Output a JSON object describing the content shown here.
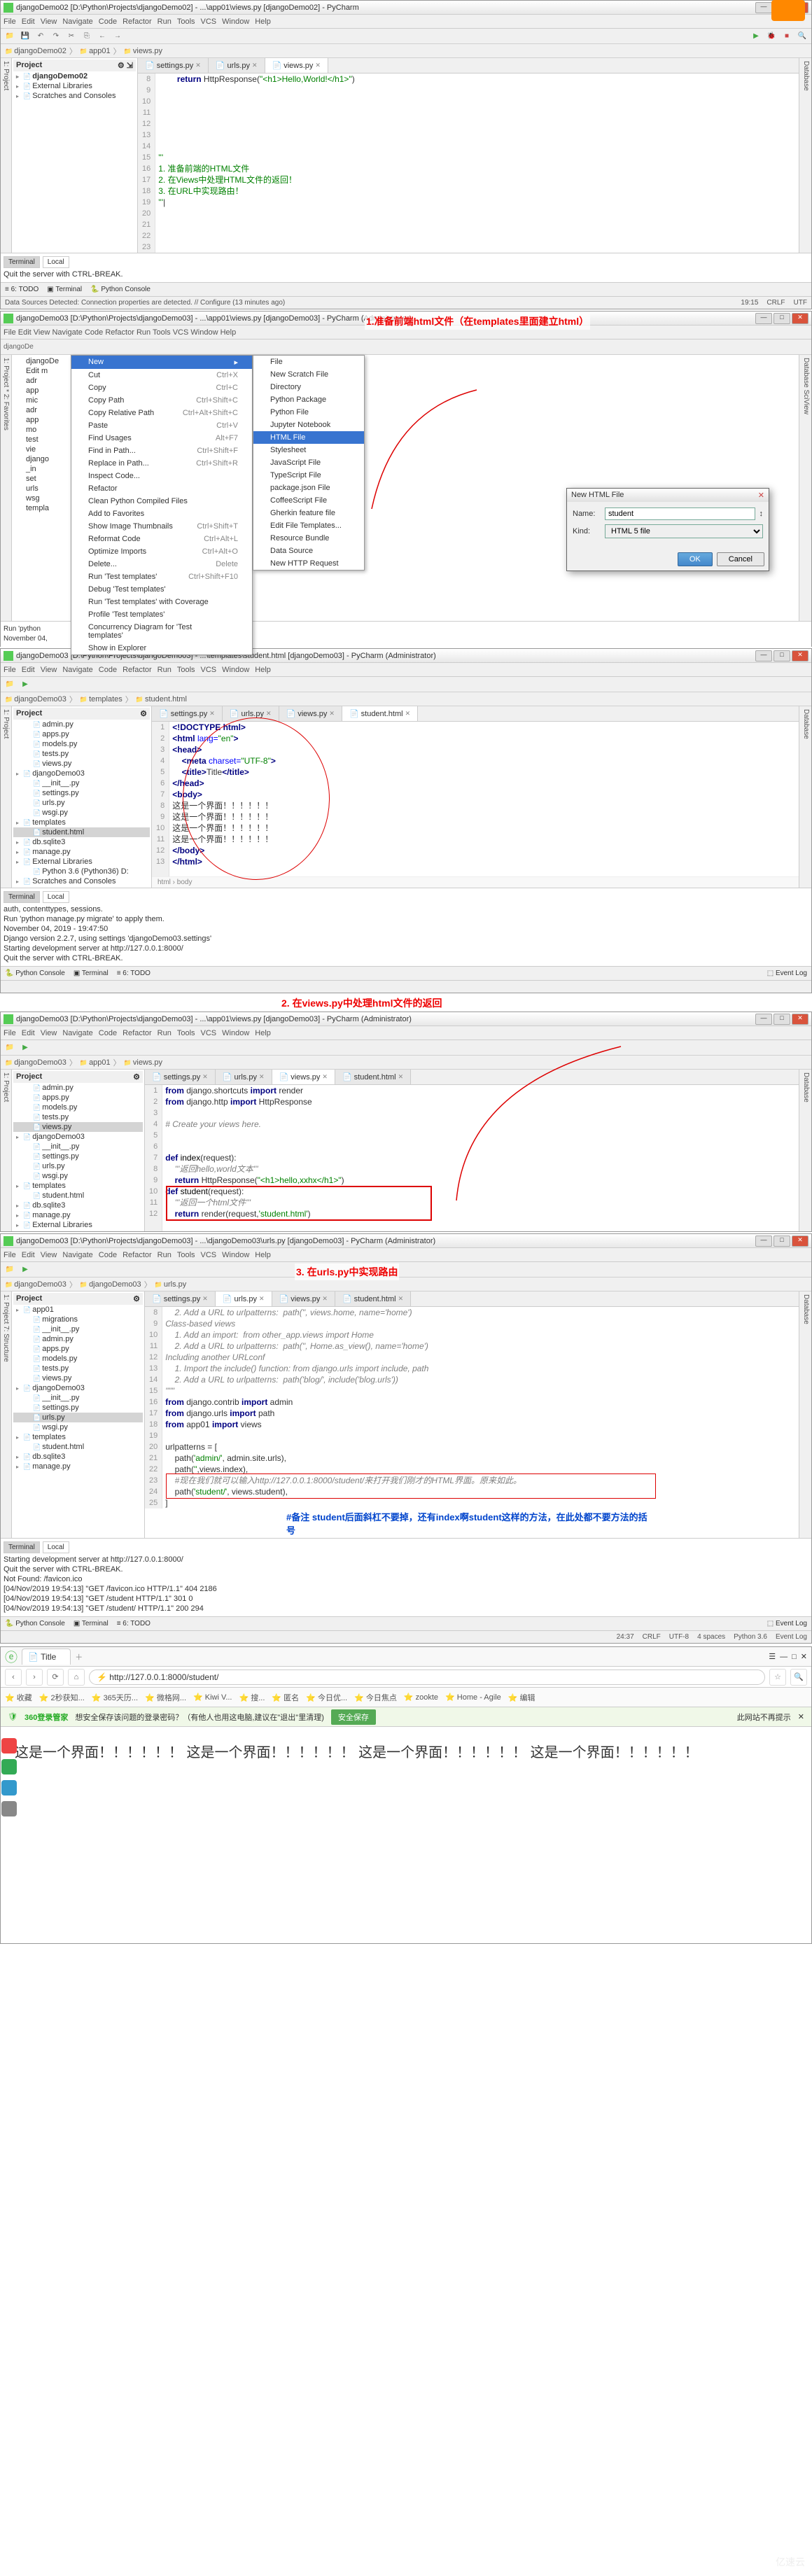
{
  "screenshot1": {
    "title": "djangoDemo02 [D:\\Python\\Projects\\djangoDemo02] - ...\\app01\\views.py [djangoDemo02] - PyCharm",
    "menus": [
      "File",
      "Edit",
      "View",
      "Navigate",
      "Code",
      "Refactor",
      "Run",
      "Tools",
      "VCS",
      "Window",
      "Help"
    ],
    "breadcrumbs": [
      "djangoDemo02",
      "app01",
      "views.py"
    ],
    "project_header": "Project",
    "tree": [
      {
        "l": 1,
        "t": "djangoDemo02",
        "bold": true
      },
      {
        "l": 1,
        "t": "External Libraries"
      },
      {
        "l": 1,
        "t": "Scratches and Consoles"
      }
    ],
    "tabs": [
      {
        "label": "settings.py"
      },
      {
        "label": "urls.py"
      },
      {
        "label": "views.py",
        "active": true
      }
    ],
    "gutter_start": 8,
    "gutter_end": 23,
    "code": [
      {
        "n": 8,
        "html": "        <span class='kw'>return</span> HttpResponse(<span class='str'>\"&lt;h1&gt;Hello,World!&lt;/h1&gt;\"</span>)"
      },
      {
        "n": 9,
        "html": ""
      },
      {
        "n": 10,
        "html": ""
      },
      {
        "n": 11,
        "html": ""
      },
      {
        "n": 12,
        "html": ""
      },
      {
        "n": 13,
        "html": ""
      },
      {
        "n": 14,
        "html": ""
      },
      {
        "n": 15,
        "html": "<span class='str'>'''</span>"
      },
      {
        "n": 16,
        "html": "<span class='str'>1. 准备前端的HTML文件</span>"
      },
      {
        "n": 17,
        "html": "<span class='str'>2. 在Views中处理HTML文件的返回！</span>"
      },
      {
        "n": 18,
        "html": "<span class='str'>3. 在URL中实现路由！</span>"
      },
      {
        "n": 19,
        "html": "<span class='str'>'''</span>|"
      },
      {
        "n": 20,
        "html": ""
      },
      {
        "n": 21,
        "html": ""
      },
      {
        "n": 22,
        "html": ""
      },
      {
        "n": 23,
        "html": ""
      }
    ],
    "terminal_tabs": [
      "Terminal",
      "Local"
    ],
    "terminal_lines": [
      "Quit the server with CTRL-BREAK.",
      ""
    ],
    "bottom": [
      "TODO",
      "Terminal",
      "Python Console"
    ],
    "databar": "Data Sources Detected: Connection properties are detected. // Configure (13 minutes ago)",
    "status_right": [
      "19:15",
      "CRLF",
      "UTF"
    ]
  },
  "screenshot2": {
    "title": "djangoDemo03 [D:\\Python\\Projects\\djangoDemo03] - ...\\app01\\views.py [djangoDemo03] - PyCharm (Administrator)",
    "annotation": "1.准备前端html文件（在templates里面建立html）",
    "menubar_note": "File  Edit  View  Navigate  Code  Refactor  Run  Tools  VCS  Window  Help",
    "context_left_header": "New",
    "context_left": [
      {
        "t": "Cut",
        "s": "Ctrl+X"
      },
      {
        "t": "Copy",
        "s": "Ctrl+C"
      },
      {
        "t": "Copy Path",
        "s": "Ctrl+Shift+C"
      },
      {
        "t": "Copy Relative Path",
        "s": "Ctrl+Alt+Shift+C"
      },
      {
        "t": "Paste",
        "s": "Ctrl+V"
      },
      {
        "t": "Find Usages",
        "s": "Alt+F7"
      },
      {
        "t": "Find in Path...",
        "s": "Ctrl+Shift+F"
      },
      {
        "t": "Replace in Path...",
        "s": "Ctrl+Shift+R"
      },
      {
        "t": "Inspect Code...",
        "s": ""
      },
      {
        "t": "Refactor",
        "s": ""
      },
      {
        "t": "Clean Python Compiled Files",
        "s": ""
      },
      {
        "t": "Add to Favorites",
        "s": ""
      },
      {
        "t": "Show Image Thumbnails",
        "s": "Ctrl+Shift+T"
      },
      {
        "t": "Reformat Code",
        "s": "Ctrl+Alt+L"
      },
      {
        "t": "Optimize Imports",
        "s": "Ctrl+Alt+O"
      },
      {
        "t": "Delete...",
        "s": "Delete"
      },
      {
        "t": "Run 'Test templates'",
        "s": "Ctrl+Shift+F10"
      },
      {
        "t": "Debug 'Test templates'",
        "s": ""
      },
      {
        "t": "Run 'Test templates' with Coverage",
        "s": ""
      },
      {
        "t": "Profile 'Test templates'",
        "s": ""
      },
      {
        "t": "Concurrency Diagram for 'Test templates'",
        "s": ""
      },
      {
        "t": "Show in Explorer",
        "s": ""
      }
    ],
    "context_right": [
      {
        "t": "File"
      },
      {
        "t": "New Scratch File"
      },
      {
        "t": "Directory"
      },
      {
        "t": "Python Package"
      },
      {
        "t": "Python File"
      },
      {
        "t": "Jupyter Notebook"
      },
      {
        "t": "HTML File",
        "hover": true
      },
      {
        "t": "Stylesheet"
      },
      {
        "t": "JavaScript File"
      },
      {
        "t": "TypeScript File"
      },
      {
        "t": "package.json File"
      },
      {
        "t": "CoffeeScript File"
      },
      {
        "t": "Gherkin feature file"
      },
      {
        "t": "Edit File Templates..."
      },
      {
        "t": "Resource Bundle"
      },
      {
        "t": "Data Source"
      },
      {
        "t": "New HTTP Request"
      }
    ],
    "tree_partial": [
      "djangoDe",
      "Edit m",
      "adr",
      "app",
      "mic",
      "adr",
      "app",
      "mo",
      "test",
      "vie",
      "django",
      "_in",
      "set",
      "urls",
      "wsg",
      "templa"
    ],
    "dialog": {
      "title": "New HTML File",
      "name_label": "Name:",
      "name_value": "student",
      "kind_label": "Kind:",
      "kind_value": "HTML 5 file",
      "ok": "OK",
      "cancel": "Cancel"
    },
    "terminal_lines": [
      "Run 'python ",
      "November 04,"
    ],
    "status_left": "2 Favorites"
  },
  "screenshot3": {
    "title": "djangoDemo03 [D:\\Python\\Projects\\djangoDemo03] - ...\\templates\\student.html [djangoDemo03] - PyCharm (Administrator)",
    "breadcrumbs": [
      "djangoDemo03",
      "templates",
      "student.html"
    ],
    "tree": [
      {
        "l": 2,
        "t": "admin.py"
      },
      {
        "l": 2,
        "t": "apps.py"
      },
      {
        "l": 2,
        "t": "models.py"
      },
      {
        "l": 2,
        "t": "tests.py"
      },
      {
        "l": 2,
        "t": "views.py"
      },
      {
        "l": 1,
        "t": "djangoDemo03"
      },
      {
        "l": 2,
        "t": "__init__.py"
      },
      {
        "l": 2,
        "t": "settings.py"
      },
      {
        "l": 2,
        "t": "urls.py"
      },
      {
        "l": 2,
        "t": "wsgi.py"
      },
      {
        "l": 1,
        "t": "templates"
      },
      {
        "l": 2,
        "t": "student.html",
        "sel": true
      },
      {
        "l": 1,
        "t": "db.sqlite3"
      },
      {
        "l": 1,
        "t": "manage.py"
      },
      {
        "l": 1,
        "t": "External Libraries"
      },
      {
        "l": 2,
        "t": "Python 3.6 (Python36) D:"
      },
      {
        "l": 1,
        "t": "Scratches and Consoles"
      }
    ],
    "tabs": [
      {
        "label": "settings.py"
      },
      {
        "label": "urls.py"
      },
      {
        "label": "views.py"
      },
      {
        "label": "student.html",
        "active": true
      }
    ],
    "code": [
      {
        "n": 1,
        "html": "<span class='tag'>&lt;!DOCTYPE html&gt;</span>"
      },
      {
        "n": 2,
        "html": "<span class='tag'>&lt;html</span> <span class='attr'>lang=</span><span class='str'>\"en\"</span><span class='tag'>&gt;</span>"
      },
      {
        "n": 3,
        "html": "<span class='tag'>&lt;head&gt;</span>"
      },
      {
        "n": 4,
        "html": "    <span class='tag'>&lt;meta</span> <span class='attr'>charset=</span><span class='str'>\"UTF-8\"</span><span class='tag'>&gt;</span>"
      },
      {
        "n": 5,
        "html": "    <span class='tag'>&lt;title&gt;</span>Title<span class='tag'>&lt;/title&gt;</span>"
      },
      {
        "n": 6,
        "html": "<span class='tag'>&lt;/head&gt;</span>"
      },
      {
        "n": 7,
        "html": "<span class='tag'>&lt;body&gt;</span>"
      },
      {
        "n": 8,
        "html": "这是一个界面！！！！！！"
      },
      {
        "n": 9,
        "html": "这是一个界面！！！！！！"
      },
      {
        "n": 10,
        "html": "这是一个界面！！！！！！"
      },
      {
        "n": 11,
        "html": "这是一个界面！！！！！！"
      },
      {
        "n": 12,
        "html": "<span class='tag'>&lt;/body&gt;</span>"
      },
      {
        "n": 13,
        "html": "<span class='tag'>&lt;/html&gt;</span>"
      }
    ],
    "breadcrumb_bottom": "html › body",
    "terminal_lines": [
      " auth, contenttypes, sessions.",
      " Run 'python manage.py migrate' to apply them.",
      "November 04, 2019 - 19:47:50",
      "Django version 2.2.7, using settings 'djangoDemo03.settings'",
      "Starting development server at http://127.0.0.1:8000/",
      "Quit the server with CTRL-BREAK."
    ],
    "bottom": [
      "Python Console",
      "Terminal",
      "TODO"
    ],
    "status_right": [
      "Event Log"
    ],
    "annotation": "2. 在views.py中处理html文件的返回"
  },
  "screenshot4": {
    "title": "djangoDemo03 [D:\\Python\\Projects\\djangoDemo03] - ...\\app01\\views.py [djangoDemo03] - PyCharm (Administrator)",
    "breadcrumbs": [
      "djangoDemo03",
      "app01",
      "views.py"
    ],
    "tree": [
      {
        "l": 2,
        "t": "admin.py"
      },
      {
        "l": 2,
        "t": "apps.py"
      },
      {
        "l": 2,
        "t": "models.py"
      },
      {
        "l": 2,
        "t": "tests.py"
      },
      {
        "l": 2,
        "t": "views.py",
        "sel": true
      },
      {
        "l": 1,
        "t": "djangoDemo03"
      },
      {
        "l": 2,
        "t": "__init__.py"
      },
      {
        "l": 2,
        "t": "settings.py"
      },
      {
        "l": 2,
        "t": "urls.py"
      },
      {
        "l": 2,
        "t": "wsgi.py"
      },
      {
        "l": 1,
        "t": "templates"
      },
      {
        "l": 2,
        "t": "student.html"
      },
      {
        "l": 1,
        "t": "db.sqlite3"
      },
      {
        "l": 1,
        "t": "manage.py"
      },
      {
        "l": 1,
        "t": "External Libraries"
      }
    ],
    "tabs": [
      {
        "label": "settings.py"
      },
      {
        "label": "urls.py"
      },
      {
        "label": "views.py",
        "active": true
      },
      {
        "label": "student.html"
      }
    ],
    "code": [
      {
        "n": 1,
        "html": "<span class='kw'>from</span> django.shortcuts <span class='kw'>import</span> render"
      },
      {
        "n": 2,
        "html": "<span class='kw'>from</span> django.http <span class='kw'>import</span> HttpResponse"
      },
      {
        "n": 3,
        "html": ""
      },
      {
        "n": 4,
        "html": "<span class='com'># Create your views here.</span>"
      },
      {
        "n": 5,
        "html": ""
      },
      {
        "n": 6,
        "html": ""
      },
      {
        "n": 7,
        "html": "<span class='kw'>def</span> <span class='fn'>index</span>(request):"
      },
      {
        "n": 8,
        "html": "    <span class='com'>'''返回hello,world文本'''</span>"
      },
      {
        "n": 9,
        "html": "    <span class='kw'>return</span> HttpResponse(<span class='str'>\"&lt;h1&gt;hello,xxhx&lt;/h1&gt;\"</span>)"
      },
      {
        "n": 10,
        "html": "<span class='kw'>def</span> <span class='fn'>student</span>(request):"
      },
      {
        "n": 11,
        "html": "    <span class='com'>'''返回一个html文件'''</span>"
      },
      {
        "n": 12,
        "html": "    <span class='kw'>return</span> render(request,<span class='str'>'student.html'</span>)"
      }
    ]
  },
  "screenshot5": {
    "title": "djangoDemo03 [D:\\Python\\Projects\\djangoDemo03] - ...\\djangoDemo03\\urls.py [djangoDemo03] - PyCharm (Administrator)",
    "annotation": "3. 在urls.py中实现路由",
    "breadcrumbs": [
      "djangoDemo03",
      "djangoDemo03",
      "urls.py"
    ],
    "tree": [
      {
        "l": 1,
        "t": "app01"
      },
      {
        "l": 2,
        "t": "migrations"
      },
      {
        "l": 2,
        "t": "__init__.py"
      },
      {
        "l": 2,
        "t": "admin.py"
      },
      {
        "l": 2,
        "t": "apps.py"
      },
      {
        "l": 2,
        "t": "models.py"
      },
      {
        "l": 2,
        "t": "tests.py"
      },
      {
        "l": 2,
        "t": "views.py"
      },
      {
        "l": 1,
        "t": "djangoDemo03"
      },
      {
        "l": 2,
        "t": "__init__.py"
      },
      {
        "l": 2,
        "t": "settings.py"
      },
      {
        "l": 2,
        "t": "urls.py",
        "sel": true
      },
      {
        "l": 2,
        "t": "wsgi.py"
      },
      {
        "l": 1,
        "t": "templates"
      },
      {
        "l": 2,
        "t": "student.html"
      },
      {
        "l": 1,
        "t": "db.sqlite3"
      },
      {
        "l": 1,
        "t": "manage.py"
      }
    ],
    "tabs": [
      {
        "label": "settings.py"
      },
      {
        "label": "urls.py",
        "active": true
      },
      {
        "label": "views.py"
      },
      {
        "label": "student.html"
      }
    ],
    "code": [
      {
        "n": 8,
        "html": "    <span class='com'>2. Add a URL to urlpatterns:  path('', views.home, name='home')</span>"
      },
      {
        "n": 9,
        "html": "<span class='com'>Class-based views</span>"
      },
      {
        "n": 10,
        "html": "    <span class='com'>1. Add an import:  from other_app.views import Home</span>"
      },
      {
        "n": 11,
        "html": "    <span class='com'>2. Add a URL to urlpatterns:  path('', Home.as_view(), name='home')</span>"
      },
      {
        "n": 12,
        "html": "<span class='com'>Including another URLconf</span>"
      },
      {
        "n": 13,
        "html": "    <span class='com'>1. Import the include() function: from django.urls import include, path</span>"
      },
      {
        "n": 14,
        "html": "    <span class='com'>2. Add a URL to urlpatterns:  path('blog/', include('blog.urls'))</span>"
      },
      {
        "n": 15,
        "html": "<span class='com'>\"\"\"</span>"
      },
      {
        "n": 16,
        "html": "<span class='kw'>from</span> django.contrib <span class='kw'>import</span> admin"
      },
      {
        "n": 17,
        "html": "<span class='kw'>from</span> django.urls <span class='kw'>import</span> path"
      },
      {
        "n": 18,
        "html": "<span class='kw'>from</span> app01 <span class='kw'>import</span> views"
      },
      {
        "n": 19,
        "html": ""
      },
      {
        "n": 20,
        "html": "urlpatterns = ["
      },
      {
        "n": 21,
        "html": "    path(<span class='str'>'admin/'</span>, admin.site.urls),"
      },
      {
        "n": 22,
        "html": "    path(<span class='str'>''</span>,views.index),"
      },
      {
        "n": 23,
        "html": "    <span class='com'>#现在我们就可以输入http://127.0.0.1:8000/student/来打开我们刚才的HTML界面。原来如此。</span>"
      },
      {
        "n": 24,
        "html": "    path(<span class='str'>'student/'</span>, views.student),"
      },
      {
        "n": 25,
        "html": "]"
      }
    ],
    "annotation2": "#备注  student后面斜杠不要掉，还有index啊student这样的方法，在此处都不要方法的括号",
    "terminal_tabs": [
      "Terminal",
      "Local"
    ],
    "terminal_lines": [
      "Starting development server at http://127.0.0.1:8000/",
      "Quit the server with CTRL-BREAK.",
      "Not Found: /favicon.ico",
      "[04/Nov/2019 19:54:13] \"GET /favicon.ico HTTP/1.1\" 404 2186",
      "[04/Nov/2019 19:54:13] \"GET /student HTTP/1.1\" 301 0",
      "[04/Nov/2019 19:54:13] \"GET /student/ HTTP/1.1\" 200 294"
    ],
    "bottom": [
      "Python Console",
      "Terminal",
      "TODO"
    ],
    "status_right": [
      "24:37",
      "CRLF",
      "UTF-8",
      "4 spaces",
      "Python 3.6",
      "Event Log"
    ]
  },
  "browser": {
    "tab": "Title",
    "url": "http://127.0.0.1:8000/student/",
    "bookmarks": [
      "收藏",
      "2秒获知...",
      "365天历...",
      "微格网...",
      "Kiwi V...",
      "搜...",
      "匿名",
      "今日优...",
      "今日焦点",
      "zookte",
      "Home - Agile",
      "编辑"
    ],
    "sectext": "想安全保存该问题的登录密码？（有他人也用这电脑,建议在\"退出\"里清理)",
    "secbtn": "安全保存",
    "secright": "此网站不再提示",
    "sec360": "360登录管家",
    "page_text": "这是一个界面！！！！！！ 这是一个界面！！！！！！ 这是一个界面！！！！！！ 这是一个界面！！！！！！"
  },
  "watermark": "亿速云"
}
